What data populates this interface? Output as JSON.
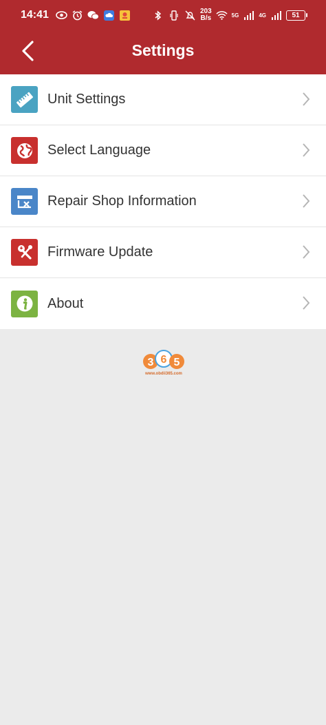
{
  "status_bar": {
    "time": "14:41",
    "net_speed_value": "203",
    "net_speed_unit": "B/s",
    "sim1_tech": "5G",
    "sim2_tech": "4G",
    "battery": "51"
  },
  "header": {
    "title": "Settings",
    "background": "#b02a2e"
  },
  "menu": {
    "items": [
      {
        "label": "Unit Settings",
        "icon": "ruler-icon",
        "color": "#4aa3c2"
      },
      {
        "label": "Select Language",
        "icon": "globe-icon",
        "color": "#c8302e"
      },
      {
        "label": "Repair Shop Information",
        "icon": "shop-icon",
        "color": "#4a86c8"
      },
      {
        "label": "Firmware Update",
        "icon": "tools-icon",
        "color": "#c8302e"
      },
      {
        "label": "About",
        "icon": "info-icon",
        "color": "#7cb342"
      }
    ]
  },
  "watermark": {
    "logo_text": "365",
    "site": "www.obdii365.com"
  }
}
